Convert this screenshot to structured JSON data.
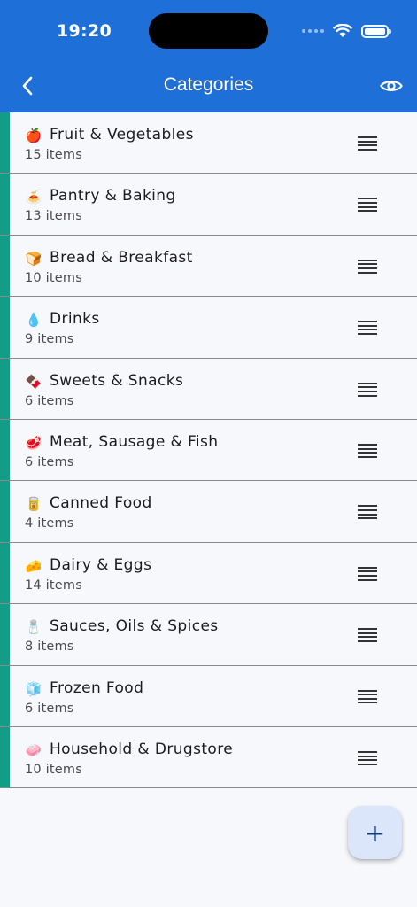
{
  "status_bar": {
    "time": "19:20"
  },
  "header": {
    "title": "Categories"
  },
  "icons": {
    "back": "chevron-left-icon",
    "visibility": "eye-icon",
    "reorder": "drag-handle-icon",
    "add": "plus-icon"
  },
  "colors": {
    "header": "#1e6fd8",
    "accent": "#139d87",
    "fab": "#dbe6fb"
  },
  "categories": [
    {
      "emoji": "🍎",
      "name": "Fruit & Vegetables",
      "count": "15 items"
    },
    {
      "emoji": "🍝",
      "name": "Pantry & Baking",
      "count": "13 items"
    },
    {
      "emoji": "🍞",
      "name": "Bread & Breakfast",
      "count": "10 items"
    },
    {
      "emoji": "💧",
      "name": "Drinks",
      "count": "9 items"
    },
    {
      "emoji": "🍫",
      "name": "Sweets & Snacks",
      "count": "6 items"
    },
    {
      "emoji": "🥩",
      "name": "Meat, Sausage & Fish",
      "count": "6 items"
    },
    {
      "emoji": "🥫",
      "name": "Canned Food",
      "count": "4 items"
    },
    {
      "emoji": "🧀",
      "name": "Dairy & Eggs",
      "count": "14 items"
    },
    {
      "emoji": "🧂",
      "name": "Sauces, Oils & Spices",
      "count": "8 items"
    },
    {
      "emoji": "🧊",
      "name": "Frozen Food",
      "count": "6 items"
    },
    {
      "emoji": "🧼",
      "name": "Household & Drugstore",
      "count": "10 items"
    }
  ],
  "fab": {
    "label": "+"
  }
}
